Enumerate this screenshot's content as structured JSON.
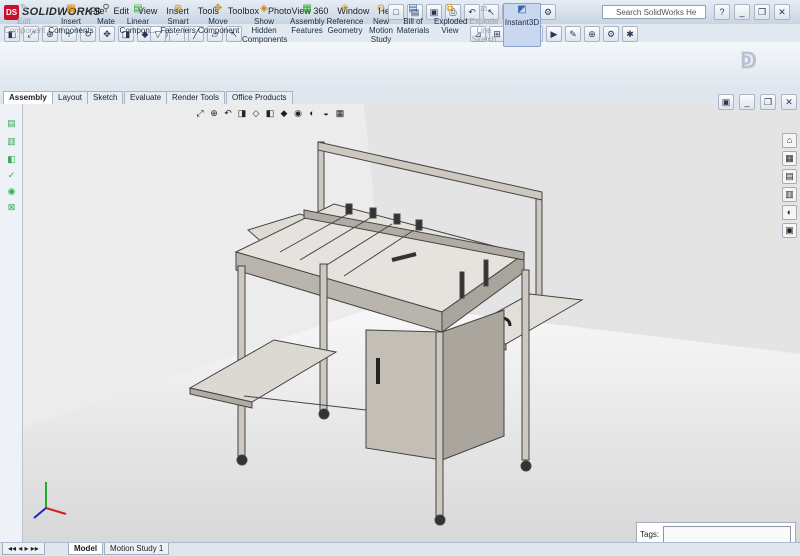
{
  "app": {
    "name": "SOLIDWORKS",
    "logo_icon": "ds-logo-icon"
  },
  "menu": [
    "File",
    "Edit",
    "View",
    "Insert",
    "Tools",
    "Toolbox",
    "PhotoView 360",
    "Window",
    "Help"
  ],
  "search": {
    "placeholder": "Search SolidWorks He"
  },
  "command_manager": [
    {
      "label": "Edit Component",
      "icon": "edit-component-icon",
      "disabled": true
    },
    {
      "label": "Insert Components",
      "icon": "insert-components-icon",
      "disabled": false
    },
    {
      "label": "Mate",
      "icon": "mate-icon",
      "disabled": false
    },
    {
      "label": "Linear Compon...",
      "icon": "linear-pattern-icon",
      "disabled": false
    },
    {
      "label": "Smart Fasteners",
      "icon": "smart-fasteners-icon",
      "disabled": false
    },
    {
      "label": "Move Component",
      "icon": "move-component-icon",
      "disabled": false
    },
    {
      "label": "Show Hidden Components",
      "icon": "show-hidden-icon",
      "disabled": false
    },
    {
      "label": "Assembly Features",
      "icon": "assembly-features-icon",
      "disabled": false
    },
    {
      "label": "Reference Geometry",
      "icon": "reference-geometry-icon",
      "disabled": false
    },
    {
      "label": "New Motion Study",
      "icon": "motion-study-icon",
      "disabled": false
    },
    {
      "label": "Bill of Materials",
      "icon": "bom-icon",
      "disabled": false
    },
    {
      "label": "Exploded View",
      "icon": "exploded-view-icon",
      "disabled": false
    },
    {
      "label": "Explode Line Sketch",
      "icon": "explode-line-icon",
      "disabled": true
    },
    {
      "label": "Instant3D",
      "icon": "instant3d-icon",
      "disabled": false,
      "active": true
    }
  ],
  "tabs": [
    "Assembly",
    "Layout",
    "Sketch",
    "Evaluate",
    "Render Tools",
    "Office Products"
  ],
  "selected_tab": "Assembly",
  "bottom_tabs": [
    "Model",
    "Motion Study 1"
  ],
  "tags": {
    "label": "Tags:",
    "value": ""
  },
  "colors": {
    "accent": "#c8102e",
    "viewport_bg": "#f2f2f2",
    "model_metal": "#c9c4bc"
  }
}
